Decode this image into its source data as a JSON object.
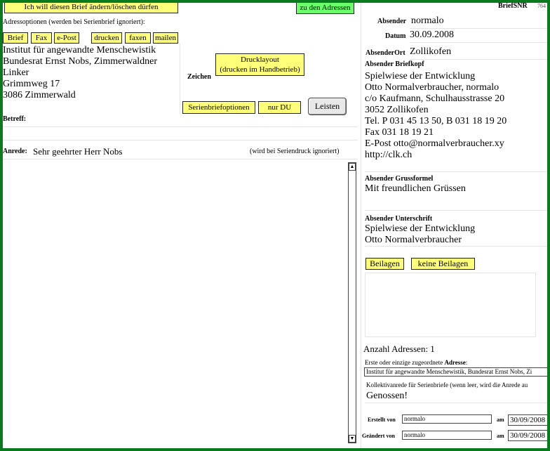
{
  "top": {
    "change_button": "Ich will diesen Brief ändern/löschen dürfen",
    "addresses_button": "zu den Adressen",
    "briefsnr_label": "BriefSNR",
    "briefsnr_value": "764"
  },
  "address_options": {
    "label": "Adressoptionen (werden bei Serienbrief ignoriert):",
    "buttons": [
      "Brief",
      "Fax",
      "e-Post",
      "drucken",
      "faxen",
      "mailen"
    ]
  },
  "address": {
    "lines": [
      "Institut für angewandte Menschewistik",
      "Bundesrat Ernst Nobs, Zimmerwaldner",
      "Linker",
      "Grimmweg 17",
      "3086 Zimmerwald"
    ]
  },
  "middle": {
    "zeichen_label": "Zeichen",
    "drucklayout_line1": "Drucklayout",
    "drucklayout_line2": "(drucken im Handbetrieb)",
    "serienbrief_button": "Serienbriefoptionen",
    "nur_du_button": "nur DU",
    "leisten_button": "Leisten"
  },
  "betreff": {
    "label": "Betreff:",
    "value": ""
  },
  "anrede": {
    "label": "Anrede:",
    "value": "Sehr geehrter Herr Nobs",
    "note": "(wird bei Seriendruck ignoriert)"
  },
  "sender": {
    "absender_label": "Absender",
    "absender_value": "normalo",
    "datum_label": "Datum",
    "datum_value": "30.09.2008",
    "ort_label": "AbsenderOrt",
    "ort_value": "Zollikofen",
    "briefkopf_label": "Absender Briefkopf",
    "briefkopf_lines": [
      "Spielwiese der Entwicklung",
      "Otto Normalverbraucher, normalo",
      "c/o Kaufmann, Schulhausstrasse 20",
      "3052 Zollikofen",
      "Tel. P 031 45 13 50, B 031 18 19 20",
      "Fax 031 18 19 21",
      "E-Post otto@normalverbraucher.xy",
      "http://clk.ch"
    ],
    "grussformel_label": "Absender Grussformel",
    "grussformel_value": "Mit freundlichen Grüssen",
    "unterschrift_label": "Absender Unterschrift",
    "unterschrift_lines": [
      "Spielwiese der Entwicklung",
      "Otto Normalverbraucher"
    ]
  },
  "beilagen": {
    "button": "Beilagen",
    "keine_button": "keine Beilagen"
  },
  "footer": {
    "anzahl_label": "Anzahl Adressen: 1",
    "erste_label_pre": "Erste oder einzige zugeordnete ",
    "erste_label_bold": "Adresse",
    "erste_label_post": ":",
    "erste_value": "Institut für angewandte Menschewistik, Bundesrat Ernst Nobs, Zi",
    "kollektiv_label": "Kollektivanrede für Serienbriefe (wenn leer, wird die Anrede au",
    "kollektiv_value": "Genossen!",
    "erstellt_label": "Erstellt von",
    "erstellt_value": "normalo",
    "erstellt_am_label": "am",
    "erstellt_am_value": "30/09/2008",
    "geaendert_label": "Geändert von",
    "geaendert_value": "normalo",
    "geaendert_am_label": "am",
    "geaendert_am_value": "30/09/2008"
  }
}
